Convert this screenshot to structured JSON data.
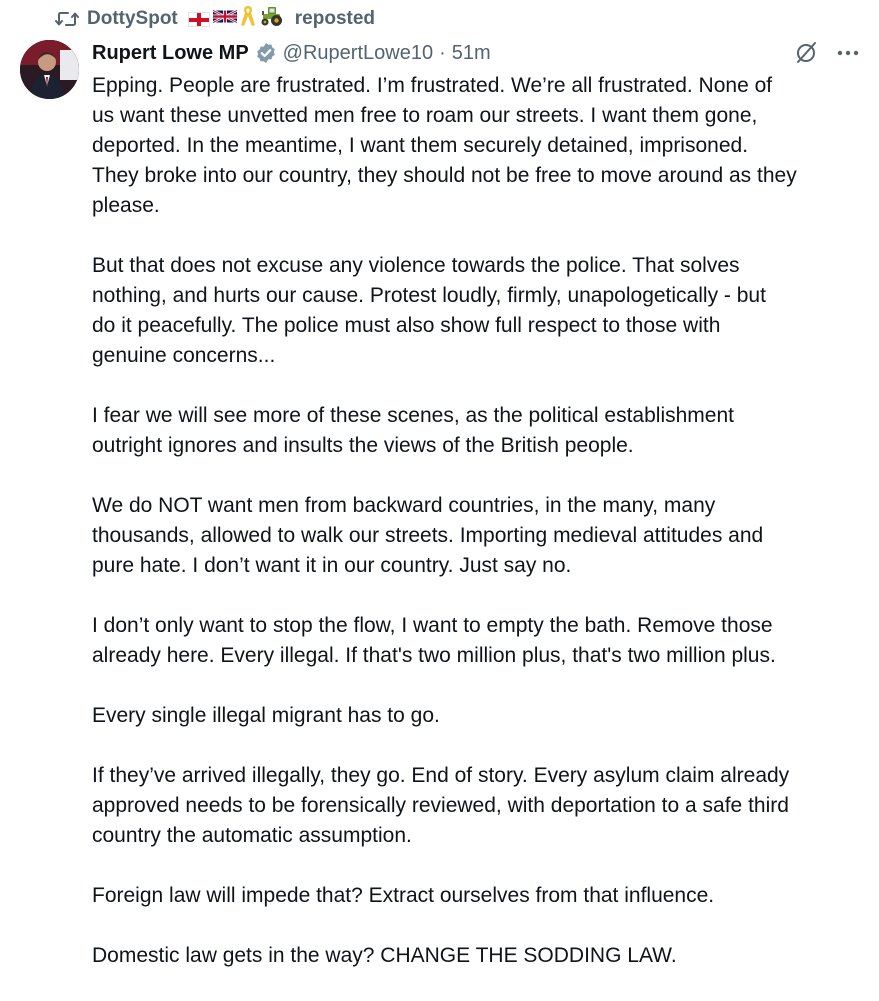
{
  "repost": {
    "name": "DottySpot",
    "verb": "reposted"
  },
  "post": {
    "author_name": "Rupert Lowe MP",
    "handle": "@RupertLowe10",
    "separator": "·",
    "time": "51m",
    "paragraphs": [
      "Epping. People are frustrated. I’m frustrated. We’re all frustrated. None of\nus want these unvetted men free to roam our streets. I want them gone,\ndeported. In the meantime, I want them securely detained, imprisoned.\nThey broke into our country, they should not be free to move around as they\nplease.",
      "But that does not excuse any violence towards the police. That solves\nnothing, and hurts our cause. Protest loudly, firmly, unapologetically - but\ndo it peacefully. The police must also show full respect to those with\ngenuine concerns...",
      "I fear we will see more of these scenes, as the political establishment\noutright ignores and insults the views of the British people.",
      "We do NOT want men from backward countries, in the many, many\nthousands, allowed to walk our streets. Importing medieval attitudes and\npure hate. I don’t want it in our country. Just say no.",
      "I don’t only want to stop the flow, I want to empty the bath. Remove those\nalready here. Every illegal. If that's two million plus, that's two million plus.",
      "Every single illegal migrant has to go.",
      "If they’ve arrived illegally, they go. End of story. Every asylum claim already\napproved needs to be forensically reviewed, with deportation to a safe third\ncountry the automatic assumption.",
      "Foreign law will impede that? Extract ourselves from that influence.",
      "Domestic law gets in the way? CHANGE THE SODDING LAW."
    ]
  },
  "icons": {
    "repost": "repost-icon",
    "verified": "verified-badge-icon",
    "grok": "grok-icon",
    "more": "more-options-icon",
    "flag_england": "england-flag-icon",
    "flag_uk": "uk-flag-icon",
    "ribbon": "yellow-ribbon-icon",
    "tractor": "tractor-icon"
  },
  "colors": {
    "text_primary": "#0f1419",
    "text_secondary": "#536471",
    "verified": "#829aab"
  }
}
